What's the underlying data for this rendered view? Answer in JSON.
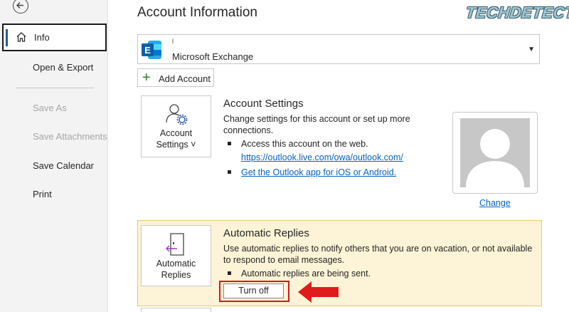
{
  "nav": {
    "info": "Info",
    "items": [
      {
        "label": "Open & Export",
        "enabled": true
      },
      {
        "label": "Save As",
        "enabled": false
      },
      {
        "label": "Save Attachments",
        "enabled": false
      },
      {
        "label": "Save Calendar",
        "enabled": true
      },
      {
        "label": "Print",
        "enabled": true
      }
    ]
  },
  "page_title": "Account Information",
  "watermark": "TECHDETECTIVE",
  "account": {
    "email": "l",
    "type": "Microsoft Exchange",
    "logo_letter": "E"
  },
  "add_account_label": "Add Account",
  "account_settings": {
    "tile_line1": "Account",
    "tile_line2": "Settings ˅",
    "title": "Account Settings",
    "description": "Change settings for this account or set up more connections.",
    "bullet1": "Access this account on the web.",
    "link1": "https://outlook.live.com/owa/outlook.com/",
    "bullet2_link": "Get the Outlook app for iOS or Android."
  },
  "profile": {
    "change_label": "Change"
  },
  "automatic_replies": {
    "tile_line1": "Automatic",
    "tile_line2": "Replies",
    "title": "Automatic Replies",
    "description": "Use automatic replies to notify others that you are on vacation, or not available to respond to email messages.",
    "status": "Automatic replies are being sent.",
    "turn_off_label": "Turn off"
  },
  "colors": {
    "accent": "#2b579a",
    "link": "#0563c1",
    "highlight_box": "#d11a1a",
    "warning_panel": "#fdf3d6"
  }
}
